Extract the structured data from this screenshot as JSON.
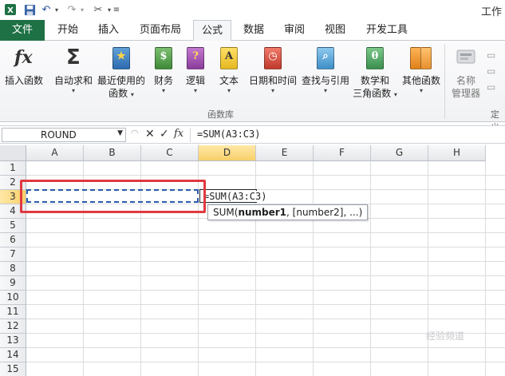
{
  "window": {
    "title": "工作"
  },
  "tabs": {
    "file": "文件",
    "home": "开始",
    "insert": "插入",
    "page_layout": "页面布局",
    "formulas": "公式",
    "data": "数据",
    "review": "审阅",
    "view": "视图",
    "developer": "开发工具"
  },
  "ribbon": {
    "insert_function": "插入函数",
    "autosum": "自动求和",
    "recent_line1": "最近使用的",
    "recent_line2": "函数",
    "financial": "财务",
    "logical": "逻辑",
    "text": "文本",
    "datetime": "日期和时间",
    "lookup": "查找与引用",
    "math_line1": "数学和",
    "math_line2": "三角函数",
    "more": "其他函数",
    "name_mgr_line1": "名称",
    "name_mgr_line2": "管理器",
    "group_library": "函数库",
    "group_defined": "定义"
  },
  "formula_bar": {
    "name_box": "ROUND",
    "formula": "=SUM(A3:C3)"
  },
  "grid": {
    "columns": [
      "A",
      "B",
      "C",
      "D",
      "E",
      "F",
      "G",
      "H"
    ],
    "rows": [
      "1",
      "2",
      "3",
      "4",
      "5",
      "6",
      "7",
      "8",
      "9",
      "10",
      "11",
      "12",
      "13",
      "14",
      "15"
    ],
    "active_cell_text": "=SUM(A3:C3)"
  },
  "tooltip": {
    "prefix": "SUM(",
    "arg1": "number1",
    "rest": ", [number2], ...)"
  },
  "watermark": "经验频道"
}
